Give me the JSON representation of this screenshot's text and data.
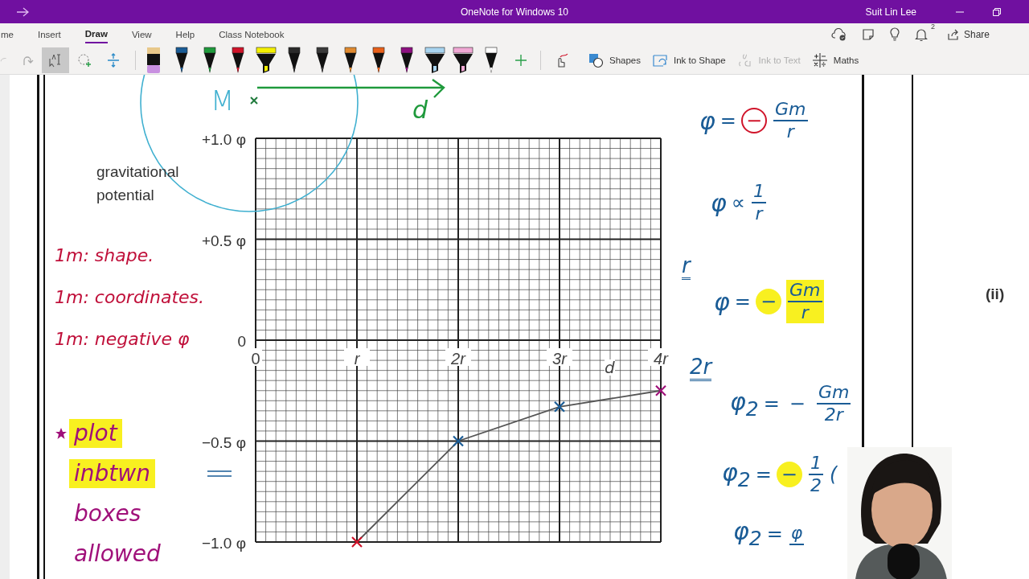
{
  "window": {
    "title": "OneNote for Windows 10",
    "user": "Suit Lin Lee"
  },
  "ribbon_tabs": [
    {
      "label": "me",
      "selected": false
    },
    {
      "label": "Insert",
      "selected": false
    },
    {
      "label": "Draw",
      "selected": true
    },
    {
      "label": "View",
      "selected": false
    },
    {
      "label": "Help",
      "selected": false
    },
    {
      "label": "Class Notebook",
      "selected": false
    }
  ],
  "notification_count": "2",
  "share_label": "Share",
  "select_tools": [
    {
      "kind": "type-select",
      "selected": true
    },
    {
      "kind": "lasso",
      "selected": false
    },
    {
      "kind": "space",
      "selected": false
    }
  ],
  "pens": [
    {
      "kind": "pencil",
      "color": "#e8c88a"
    },
    {
      "kind": "pen",
      "color": "#1a5c96"
    },
    {
      "kind": "pen",
      "color": "#1f9a3c"
    },
    {
      "kind": "pen",
      "color": "#d0142a"
    },
    {
      "kind": "highlighter",
      "color": "#f4f000"
    },
    {
      "kind": "pen",
      "color": "#2a2a2a"
    },
    {
      "kind": "pen",
      "color": "#3a3a3a"
    },
    {
      "kind": "pen",
      "color": "#e08a30"
    },
    {
      "kind": "pen",
      "color": "#e8601a"
    },
    {
      "kind": "pen",
      "color": "#8c1080"
    },
    {
      "kind": "highlighter",
      "color": "#a8d4f0"
    },
    {
      "kind": "highlighter",
      "color": "#f0a8d4"
    },
    {
      "kind": "pen",
      "color": "#ffffff"
    }
  ],
  "tools": [
    {
      "kind": "shapes",
      "label": "Shapes",
      "disabled": false
    },
    {
      "kind": "ink-to-shape",
      "label": "Ink to Shape",
      "disabled": false
    },
    {
      "kind": "ink-to-text",
      "label": "Ink to Text",
      "disabled": true
    },
    {
      "kind": "maths",
      "label": "Maths",
      "disabled": false
    }
  ],
  "page": {
    "sphere_label": "M",
    "distance_label": "d",
    "curve_label": "d",
    "axis_label": "gravitational potential",
    "part_label": "(ii)",
    "mark_notes": [
      {
        "text": "1m: shape.",
        "color": "#c0103a"
      },
      {
        "text": "1m: coordinates.",
        "color": "#c0103a"
      },
      {
        "text": "1m: negative φ",
        "color": "#c0103a"
      }
    ],
    "tips": [
      {
        "text": "plot",
        "color": "#a0107a",
        "highlight": true,
        "starred": true
      },
      {
        "text": "inbtwn",
        "color": "#a0107a",
        "highlight": true,
        "starred": false
      },
      {
        "text": "boxes",
        "color": "#a0107a",
        "highlight": false,
        "starred": false
      },
      {
        "text": "allowed",
        "color": "#a0107a",
        "highlight": false,
        "starred": false
      }
    ],
    "side_labels": [
      "r",
      "2r"
    ],
    "equations": [
      {
        "lhs": "φ",
        "op": "=",
        "sign": "−",
        "num": "Gm",
        "den": "r",
        "sign_circled": true,
        "sign_highlighted": false,
        "fraction_highlighted": false
      },
      {
        "lhs": "φ",
        "op": "∝",
        "num": "1",
        "den": "r",
        "fraction_highlighted": false
      },
      {
        "lhs": "φ",
        "op": "=",
        "sign": "−",
        "num": "Gm",
        "den": "r",
        "sign_circled": false,
        "sign_highlighted": true,
        "fraction_highlighted": true
      },
      {
        "lhs": "φ$_{2}$",
        "op": "=",
        "sign": "−",
        "num": "Gm",
        "den": "2r",
        "sign_circled": false,
        "sign_highlighted": false,
        "fraction_highlighted": false
      },
      {
        "lhs": "φ$_{2}$",
        "op": "=",
        "sign": "−",
        "num": "1",
        "den": "2",
        "tail": "(",
        "sign_circled": false,
        "sign_highlighted": true,
        "fraction_highlighted": false
      },
      {
        "lhs": "φ$_{2}$",
        "op": "=",
        "num": "φ",
        "fraction_highlighted": false
      }
    ],
    "chart_data": {
      "type": "line",
      "grid": true,
      "x": [
        1,
        2,
        3,
        4
      ],
      "series": [
        {
          "color": "#555555",
          "marker": "x",
          "values": [
            -1.0,
            -0.5,
            -0.33,
            -0.25
          ]
        }
      ],
      "xlim": [
        0,
        4
      ],
      "ylim": [
        -1,
        1
      ],
      "xticks": [
        {
          "value": 0,
          "label": "0"
        },
        {
          "value": 1,
          "label": "r"
        },
        {
          "value": 2,
          "label": "2r"
        },
        {
          "value": 3,
          "label": "3r"
        },
        {
          "value": 4,
          "label": "4r"
        }
      ],
      "yticks": [
        {
          "value": 1,
          "label": "+1.0 φ"
        },
        {
          "value": 0.5,
          "label": "+0.5 φ"
        },
        {
          "value": 0,
          "label": "0"
        },
        {
          "value": -0.5,
          "label": "−0.5 φ"
        },
        {
          "value": -1,
          "label": "−1.0 φ"
        }
      ]
    },
    "point_marks": [
      {
        "color": "#d0142a"
      },
      {
        "color": "#1a5c96"
      },
      {
        "color": "#1a5c96"
      },
      {
        "color": "#a0107a"
      }
    ]
  }
}
